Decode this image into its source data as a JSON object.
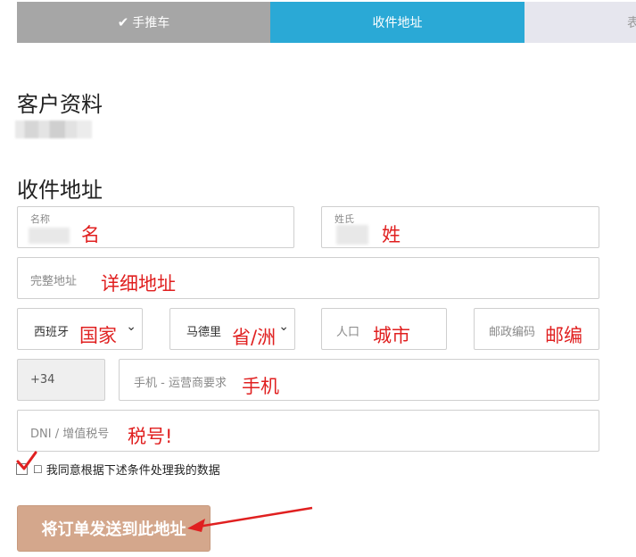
{
  "steps": {
    "cart_label": "手推车",
    "address_label": "收件地址",
    "next_label": "表"
  },
  "customer": {
    "title": "客户资料"
  },
  "address": {
    "title": "收件地址",
    "first_name_label": "名称",
    "last_name_label": "姓氏",
    "full_address_placeholder": "完整地址",
    "country_value": "西班牙",
    "region_value": "马德里",
    "city_placeholder": "人口",
    "zip_placeholder": "邮政编码",
    "phone_prefix": "+34",
    "phone_placeholder": "手机 - 运营商要求",
    "tax_placeholder": "DNI / 增值税号"
  },
  "annotations": {
    "first_name": "名",
    "last_name": "姓",
    "full_address": "详细地址",
    "country": "国家",
    "region": "省/洲",
    "city": "城市",
    "zip": "邮编",
    "phone": "手机",
    "tax": "税号!"
  },
  "consent": {
    "label": "我同意根据下述条件处理我的数据"
  },
  "submit": {
    "label": "将订单发送到此地址"
  },
  "colors": {
    "step_done": "#a6a6a6",
    "step_active": "#2aa9d6",
    "step_next": "#e6e6ee",
    "submit_bg": "#d4a78c",
    "annotation_red": "#e02020"
  }
}
